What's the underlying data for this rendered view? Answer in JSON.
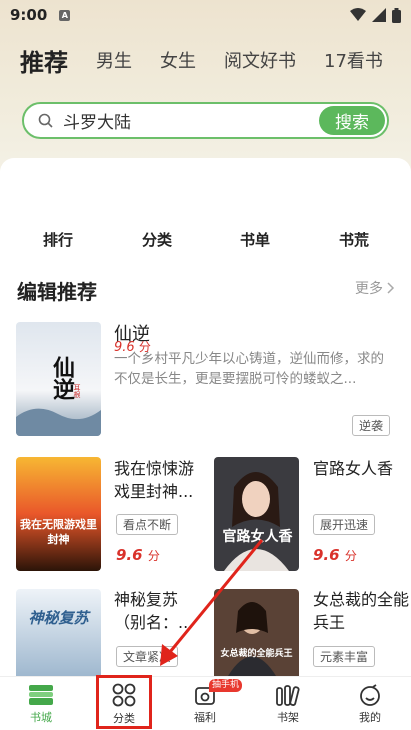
{
  "status_bar": {
    "time": "9:00",
    "notif_glyph": "A"
  },
  "tabs": [
    "推荐",
    "男生",
    "女生",
    "阅文好书",
    "17看书"
  ],
  "search": {
    "value": "斗罗大陆",
    "button": "搜索"
  },
  "quick_links": [
    "排行",
    "分类",
    "书单",
    "书荒"
  ],
  "section": {
    "title": "编辑推荐",
    "more": "更多"
  },
  "featured": {
    "title": "仙逆",
    "score": "9.6",
    "score_unit": "分",
    "description": "一个乡村平凡少年以心铸道，逆仙而修，求的不仅是长生，更是要摆脱可怜的蝼蚁之...",
    "tag": "逆袭",
    "cover_text": "仙逆",
    "cover_author": "耳根"
  },
  "books": [
    {
      "title": "我在惊悚游戏里封神...",
      "tag": "看点不断",
      "score": "9.6",
      "unit": "分",
      "cover_text": "我在无限游戏里封神"
    },
    {
      "title": "官路女人香",
      "tag": "展开迅速",
      "score": "9.6",
      "unit": "分",
      "cover_text": "官路女人香"
    },
    {
      "title": "神秘复苏（别名：...",
      "tag": "文章紧凑",
      "cover_text": "神秘复苏"
    },
    {
      "title": "女总裁的全能兵王",
      "tag": "元素丰富",
      "cover_text": "女总裁的全能兵王"
    }
  ],
  "bottom_nav": [
    {
      "label": "书城",
      "icon": "bookstore-icon"
    },
    {
      "label": "分类",
      "icon": "category-icon"
    },
    {
      "label": "福利",
      "icon": "welfare-icon"
    },
    {
      "label": "书架",
      "icon": "bookshelf-icon"
    },
    {
      "label": "我的",
      "icon": "profile-icon"
    }
  ],
  "welfare_badge": "抽手机",
  "colors": {
    "accent": "#5cb85c",
    "price": "#d9322b",
    "highlight": "#e0241b"
  }
}
